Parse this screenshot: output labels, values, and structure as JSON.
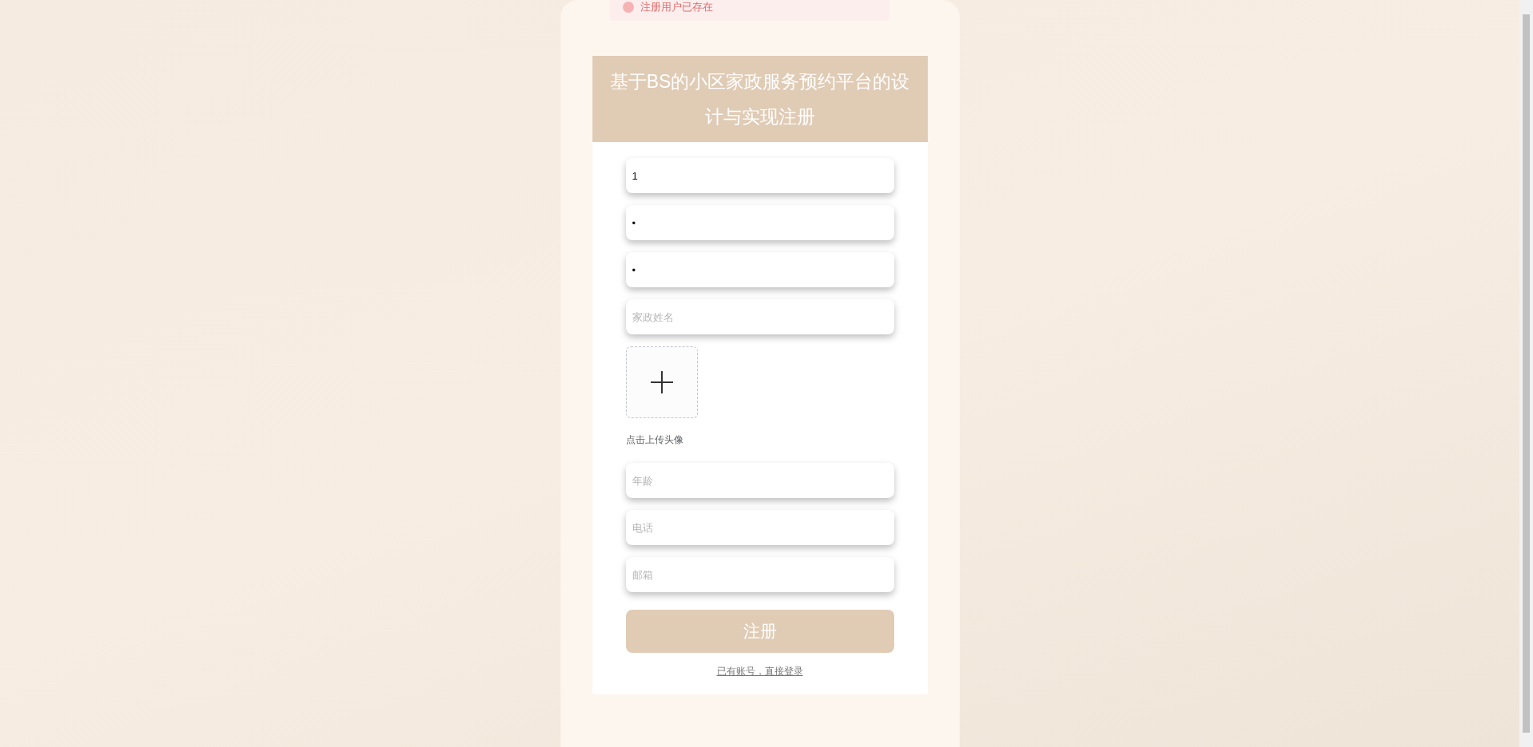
{
  "toast": {
    "text": "注册用户已存在"
  },
  "title": "基于BS的小区家政服务预约平台的设计与实现注册",
  "fields_top": [
    {
      "value": "1"
    },
    {
      "value": "•"
    },
    {
      "value": "•"
    },
    {
      "placeholder": "家政姓名"
    }
  ],
  "upload": {
    "label": "点击上传头像"
  },
  "fields_bottom": [
    {
      "placeholder": "年龄"
    },
    {
      "placeholder": "电话"
    },
    {
      "placeholder": "邮箱"
    }
  ],
  "submit": "注册",
  "login_link": "已有账号，直接登录"
}
